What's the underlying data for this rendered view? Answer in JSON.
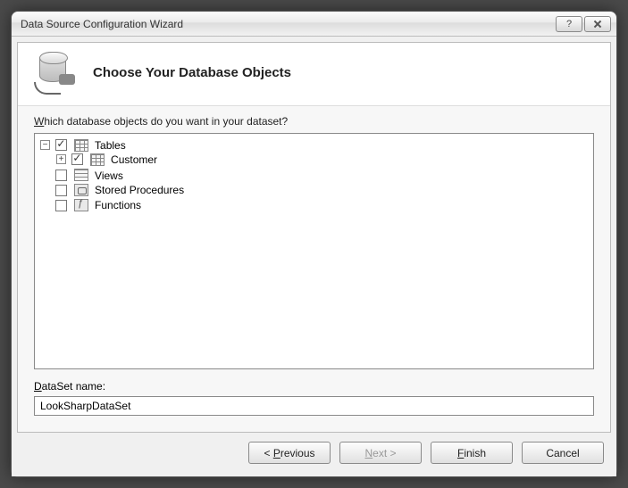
{
  "window": {
    "title": "Data Source Configuration Wizard"
  },
  "header": {
    "title": "Choose Your Database Objects"
  },
  "prompt": {
    "prefix_underlined": "W",
    "rest": "hich database objects do you want in your dataset?"
  },
  "tree": {
    "tables": {
      "label": "Tables",
      "checked": true,
      "expanded": true
    },
    "customer": {
      "label": "Customer",
      "checked": true,
      "expanded": false
    },
    "views": {
      "label": "Views",
      "checked": false
    },
    "stored_procedures": {
      "label": "Stored Procedures",
      "checked": false
    },
    "functions": {
      "label": "Functions",
      "checked": false
    }
  },
  "dataset": {
    "label_underlined": "D",
    "label_rest": "ataSet name:",
    "value": "LookSharpDataSet"
  },
  "buttons": {
    "previous_prefix": "< ",
    "previous_u": "P",
    "previous_rest": "revious",
    "next_u": "N",
    "next_rest": "ext >",
    "finish_u": "F",
    "finish_rest": "inish",
    "cancel": "Cancel"
  }
}
